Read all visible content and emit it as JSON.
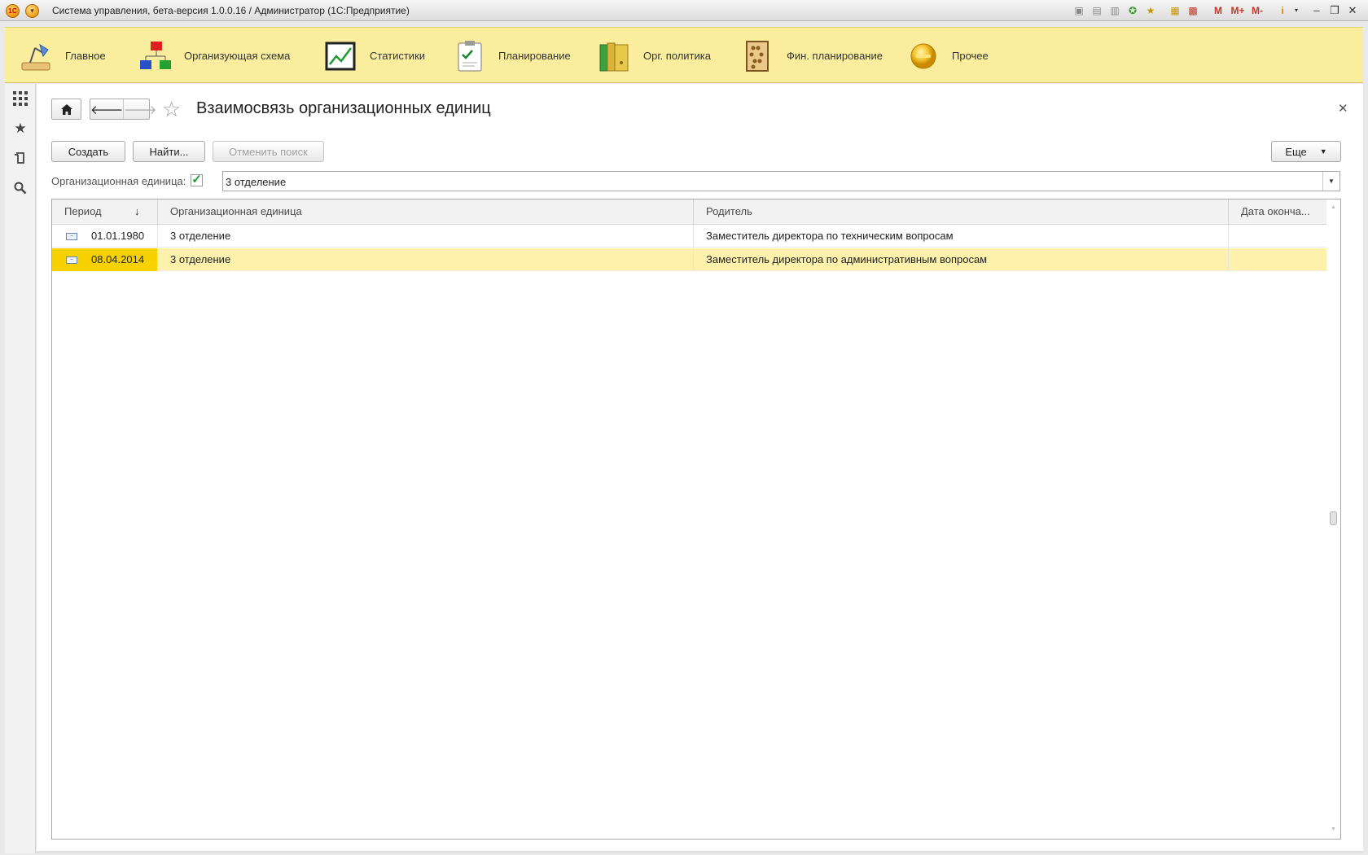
{
  "window": {
    "title": "Система управления, бета-версия 1.0.0.16 / Администратор  (1С:Предприятие)",
    "logo_text": "1С",
    "tools": {
      "m_label": "M",
      "m_plus_label": "M+",
      "m_minus_label": "M-",
      "info_label": "i"
    }
  },
  "sections": [
    {
      "label": "Главное",
      "icon": "desk-lamp-icon"
    },
    {
      "label": "Организующая схема",
      "icon": "org-chart-icon"
    },
    {
      "label": "Статистики",
      "icon": "statistics-chart-icon"
    },
    {
      "label": "Планирование",
      "icon": "checklist-clipboard-icon"
    },
    {
      "label": "Орг. политика",
      "icon": "binders-icon"
    },
    {
      "label": "Фин. планирование",
      "icon": "abacus-icon"
    },
    {
      "label": "Прочее",
      "icon": "yellow-circle-icon"
    }
  ],
  "leftbar": [
    "grid-menu-icon",
    "favorites-star-icon",
    "history-icon",
    "search-icon"
  ],
  "form": {
    "title": "Взаимосвязь организационных единиц"
  },
  "toolbar": {
    "create_label": "Создать",
    "find_label": "Найти...",
    "cancel_search_label": "Отменить поиск",
    "more_label": "Еще"
  },
  "filter": {
    "label": "Организационная единица:",
    "checked": true,
    "value": "3 отделение"
  },
  "table": {
    "columns": [
      "Период",
      "Организационная единица",
      "Родитель",
      "Дата оконча..."
    ],
    "sort_indicator": "↓",
    "rows": [
      {
        "period": "01.01.1980",
        "unit": "3 отделение",
        "parent": "Заместитель директора по техническим вопросам",
        "end_date": "",
        "selected": false
      },
      {
        "period": "08.04.2014",
        "unit": "3 отделение",
        "parent": "Заместитель директора по административным вопросам",
        "end_date": "",
        "selected": true
      }
    ]
  },
  "colors": {
    "sections_bg": "#fbed9e",
    "selected_row": "#fdf1ac",
    "selected_cell": "#f7d200"
  }
}
